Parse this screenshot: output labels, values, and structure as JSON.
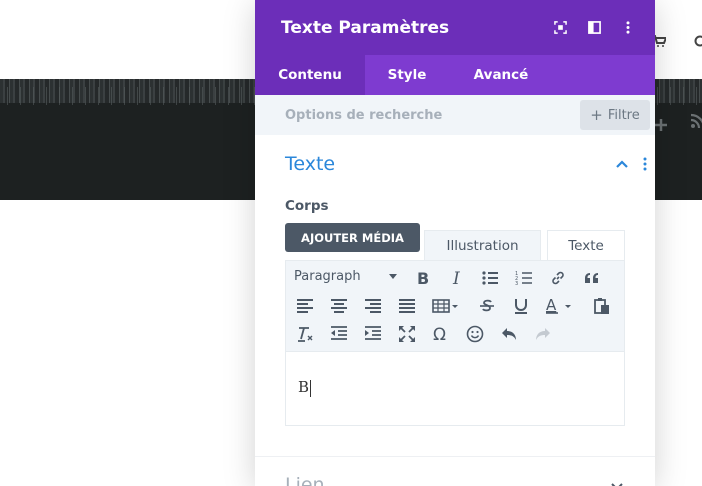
{
  "panel": {
    "title": "Texte Paramètres",
    "header_icons": [
      "screenshot-icon",
      "split-view-icon",
      "more-options-icon"
    ]
  },
  "tabs": [
    {
      "label": "Contenu",
      "active": true
    },
    {
      "label": "Style",
      "active": false
    },
    {
      "label": "Avancé",
      "active": false
    }
  ],
  "search": {
    "placeholder": "Options de recherche",
    "filter_label": "Filtre"
  },
  "section": {
    "title": "Texte",
    "field_label": "Corps",
    "add_media_label": "AJOUTER MÉDIA",
    "editor_tabs": {
      "visual": "Illustration",
      "text": "Texte"
    },
    "format_select": "Paragraph",
    "content": "B"
  },
  "next_section": {
    "title": "Lien"
  },
  "colors": {
    "header": "#6c2eb9",
    "tabs_bar": "#7e3bd0",
    "section_title": "#2b87da",
    "button_dark": "#4c5866"
  }
}
